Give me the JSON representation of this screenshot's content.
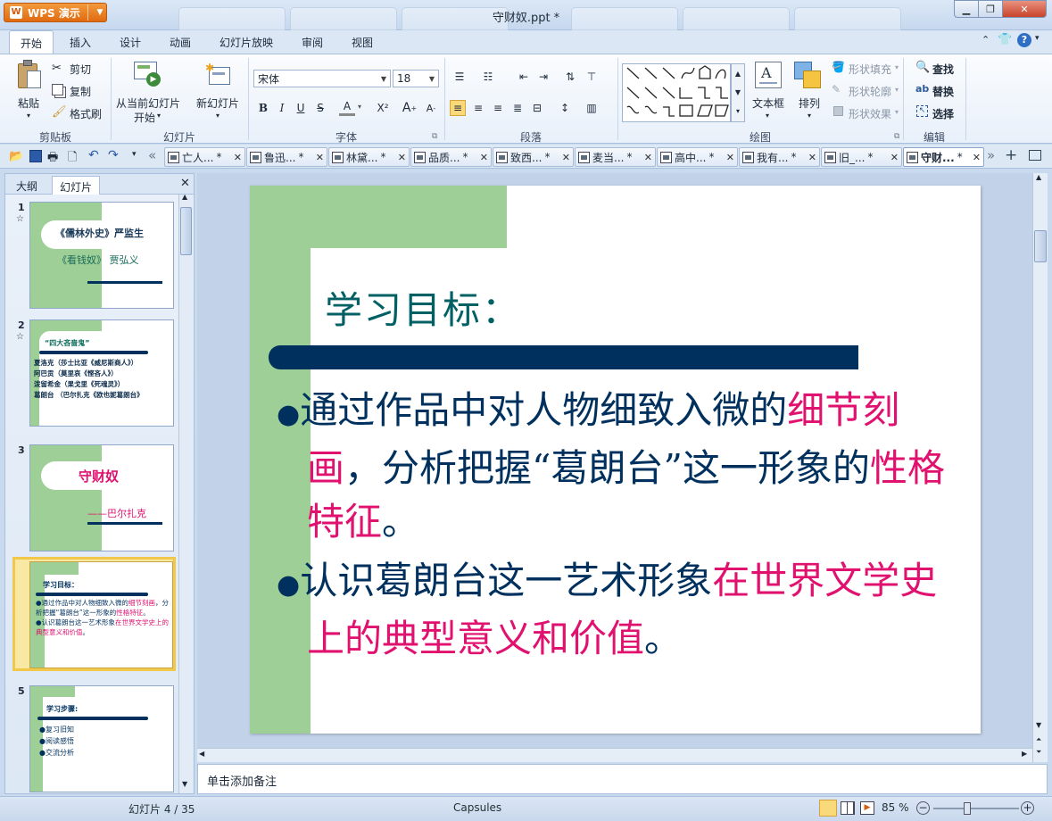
{
  "app": {
    "name": "WPS 演示",
    "window_title": "守财奴.ppt *"
  },
  "menu": [
    {
      "label": "开始",
      "active": true
    },
    {
      "label": "插入"
    },
    {
      "label": "设计"
    },
    {
      "label": "动画"
    },
    {
      "label": "幻灯片放映"
    },
    {
      "label": "审阅"
    },
    {
      "label": "视图"
    }
  ],
  "ribbon": {
    "clipboard": {
      "paste": "粘贴",
      "cut": "剪切",
      "copy": "复制",
      "format_painter": "格式刷",
      "group": "剪贴板"
    },
    "slides": {
      "from_current_1": "从当前幻灯片",
      "from_current_2": "开始",
      "new_slide": "新幻灯片",
      "group": "幻灯片"
    },
    "font": {
      "name": "宋体",
      "size": "18",
      "group": "字体",
      "bold": "B",
      "italic": "I",
      "underline": "U",
      "strike": "S",
      "color": "A"
    },
    "paragraph": {
      "group": "段落"
    },
    "drawing": {
      "text_box": "文本框",
      "arrange": "排列",
      "shape_fill": "形状填充",
      "shape_outline": "形状轮廓",
      "shape_effect": "形状效果",
      "group": "绘图"
    },
    "editing": {
      "find": "查找",
      "replace": "替换",
      "select": "选择",
      "group": "编辑"
    }
  },
  "doc_tabs": [
    "亡人...",
    "鲁迅...",
    "林黛...",
    "品质...",
    "致西...",
    "麦当...",
    "高中...",
    "我有...",
    "旧_...",
    "守财..."
  ],
  "doc_tab_suffix": "*",
  "panel": {
    "tab_outline": "大纲",
    "tab_slides": "幻灯片"
  },
  "thumbnails": [
    {
      "num": "1",
      "title": "《儒林外史》严监生",
      "subtitle": "《看钱奴》 贾弘义"
    },
    {
      "num": "2",
      "title": "“四大吝啬鬼”",
      "lines": [
        "夏洛克（莎士比亚《威尼斯商人》）",
        "阿巴贡（莫里哀《悭吝人》）",
        "泼留希金（果戈里《死魂灵》）",
        "葛朗台 （巴尔扎克《欧也妮葛朗台》"
      ]
    },
    {
      "num": "3",
      "title": "守财奴",
      "subtitle": "——巴尔扎克"
    },
    {
      "num": "4",
      "title": "学习目标：",
      "b1_a": "通过作品中对人物细致入微的",
      "b1_b": "细节刻画",
      "b1_c": "，分析把握“葛朗台”这一形象的",
      "b1_d": "性格特征",
      "b1_e": "。",
      "b2_a": "认识葛朗台这一艺术形象",
      "b2_b": "在世界文学史上的典型意义和价值",
      "b2_c": "。"
    },
    {
      "num": "5",
      "title": "学习步骤:",
      "items": [
        "复习旧知",
        "阅读感悟",
        "交流分析"
      ]
    }
  ],
  "slide": {
    "title": "学习目标：",
    "bullet1": {
      "a": "通过作品中对人物细致入微的",
      "b": "细节刻画",
      "c": "，分析把握“葛朗台”这一形象的",
      "d": "性格特征",
      "e": "。"
    },
    "bullet2": {
      "a": "认识葛朗台这一艺术形象",
      "b": "在世界文学史上的典型意义和价值",
      "c": "。"
    }
  },
  "notes_placeholder": "单击添加备注",
  "status": {
    "slide_counter": "幻灯片 4 / 35",
    "theme": "Capsules",
    "zoom": "85 %"
  },
  "colors": {
    "accent_green": "#9ecf96",
    "navy": "#00315e",
    "pink": "#e0116f",
    "title_teal": "#006064"
  }
}
